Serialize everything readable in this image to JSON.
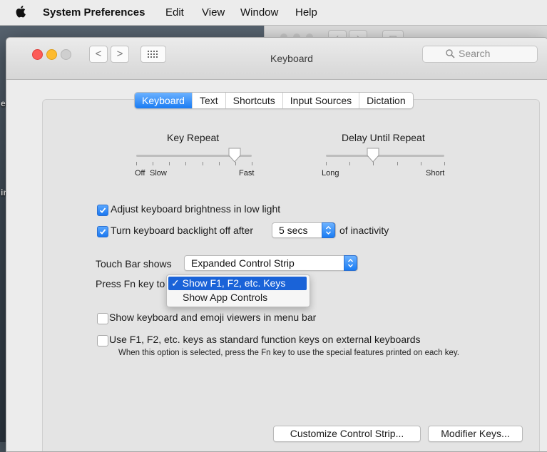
{
  "menubar": {
    "app_name": "System Preferences",
    "items": [
      "Edit",
      "View",
      "Window",
      "Help"
    ]
  },
  "desktop": {
    "labels": [
      "ea",
      "im"
    ]
  },
  "window": {
    "title": "Keyboard",
    "search_placeholder": "Search",
    "nav": {
      "back": "<",
      "forward": ">"
    }
  },
  "tabs": [
    {
      "label": "Keyboard",
      "selected": true
    },
    {
      "label": "Text",
      "selected": false
    },
    {
      "label": "Shortcuts",
      "selected": false
    },
    {
      "label": "Input Sources",
      "selected": false
    },
    {
      "label": "Dictation",
      "selected": false
    }
  ],
  "key_repeat": {
    "label": "Key Repeat",
    "min_label": "Off",
    "left_label": "Slow",
    "right_label": "Fast",
    "level": 0.85
  },
  "delay_until_repeat": {
    "label": "Delay Until Repeat",
    "left_label": "Long",
    "right_label": "Short",
    "level": 0.4
  },
  "options": {
    "brightness": {
      "label": "Adjust keyboard brightness in low light",
      "checked": true
    },
    "backlight_off": {
      "label": "Turn keyboard backlight off after",
      "checked": true,
      "value": "5 secs",
      "suffix": "of inactivity"
    }
  },
  "touch_bar": {
    "label": "Touch Bar shows",
    "value": "Expanded Control Strip"
  },
  "fn_key": {
    "label": "Press Fn key to",
    "menu_options": [
      {
        "label": "✓ Show F1, F2, etc. Keys",
        "highlighted": true
      },
      {
        "label": "Show App Controls",
        "highlighted": false
      }
    ]
  },
  "extra_options": {
    "viewers": {
      "label": "Show keyboard and emoji viewers in menu bar",
      "checked": false
    },
    "function_keys": {
      "label": "Use F1, F2, etc. keys as standard function keys on external keyboards",
      "checked": false,
      "note": "When this option is selected, press the Fn key to use the special features printed on each key."
    }
  },
  "buttons": {
    "customize": "Customize Control Strip...",
    "modifier": "Modifier Keys..."
  },
  "colors": {
    "accent": "#1a7cf3",
    "menu_highlight": "#1a63d8",
    "close": "#fc5b57",
    "minimize": "#fdbb2f"
  }
}
